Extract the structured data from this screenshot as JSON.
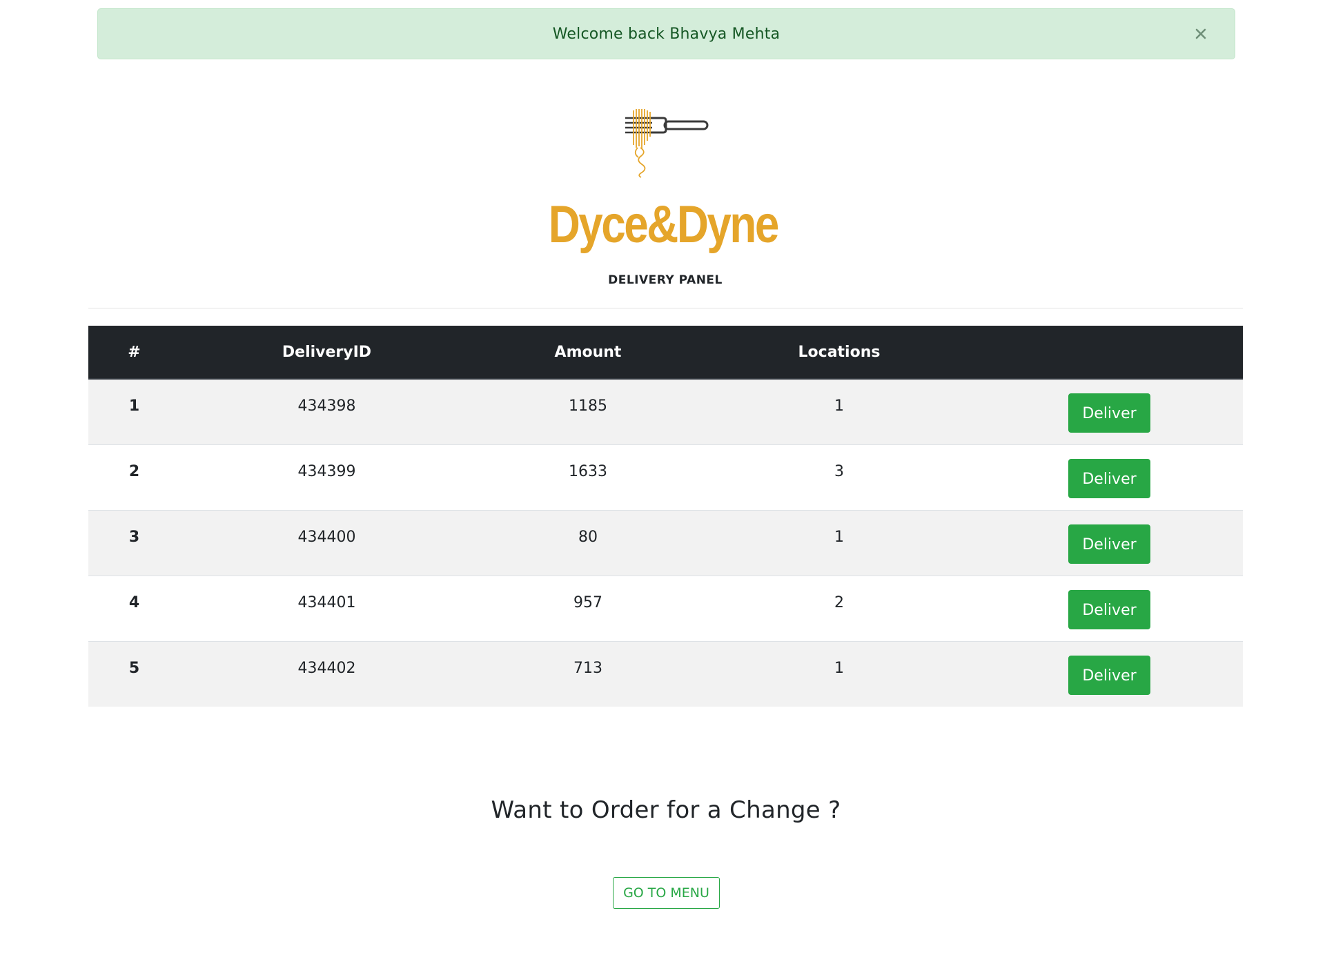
{
  "alert": {
    "message": "Welcome back Bhavya Mehta",
    "close_symbol": "×"
  },
  "brand": {
    "name": "Dyce&Dyne",
    "subtitle": "DELIVERY PANEL",
    "logo_icon": "fork-noodles-icon"
  },
  "table": {
    "headers": [
      "#",
      "DeliveryID",
      "Amount",
      "Locations",
      ""
    ],
    "rows": [
      {
        "num": "1",
        "delivery_id": "434398",
        "amount": "1185",
        "locations": "1",
        "action": "Deliver"
      },
      {
        "num": "2",
        "delivery_id": "434399",
        "amount": "1633",
        "locations": "3",
        "action": "Deliver"
      },
      {
        "num": "3",
        "delivery_id": "434400",
        "amount": "80",
        "locations": "1",
        "action": "Deliver"
      },
      {
        "num": "4",
        "delivery_id": "434401",
        "amount": "957",
        "locations": "2",
        "action": "Deliver"
      },
      {
        "num": "5",
        "delivery_id": "434402",
        "amount": "713",
        "locations": "1",
        "action": "Deliver"
      }
    ]
  },
  "cta": {
    "title": "Want to Order for a Change ?",
    "button": "GO TO MENU"
  },
  "colors": {
    "alert_bg": "#d4edda",
    "alert_text": "#155724",
    "brand": "#e5a52a",
    "table_header": "#212529",
    "success": "#28a745",
    "stripe": "#f2f2f2"
  }
}
